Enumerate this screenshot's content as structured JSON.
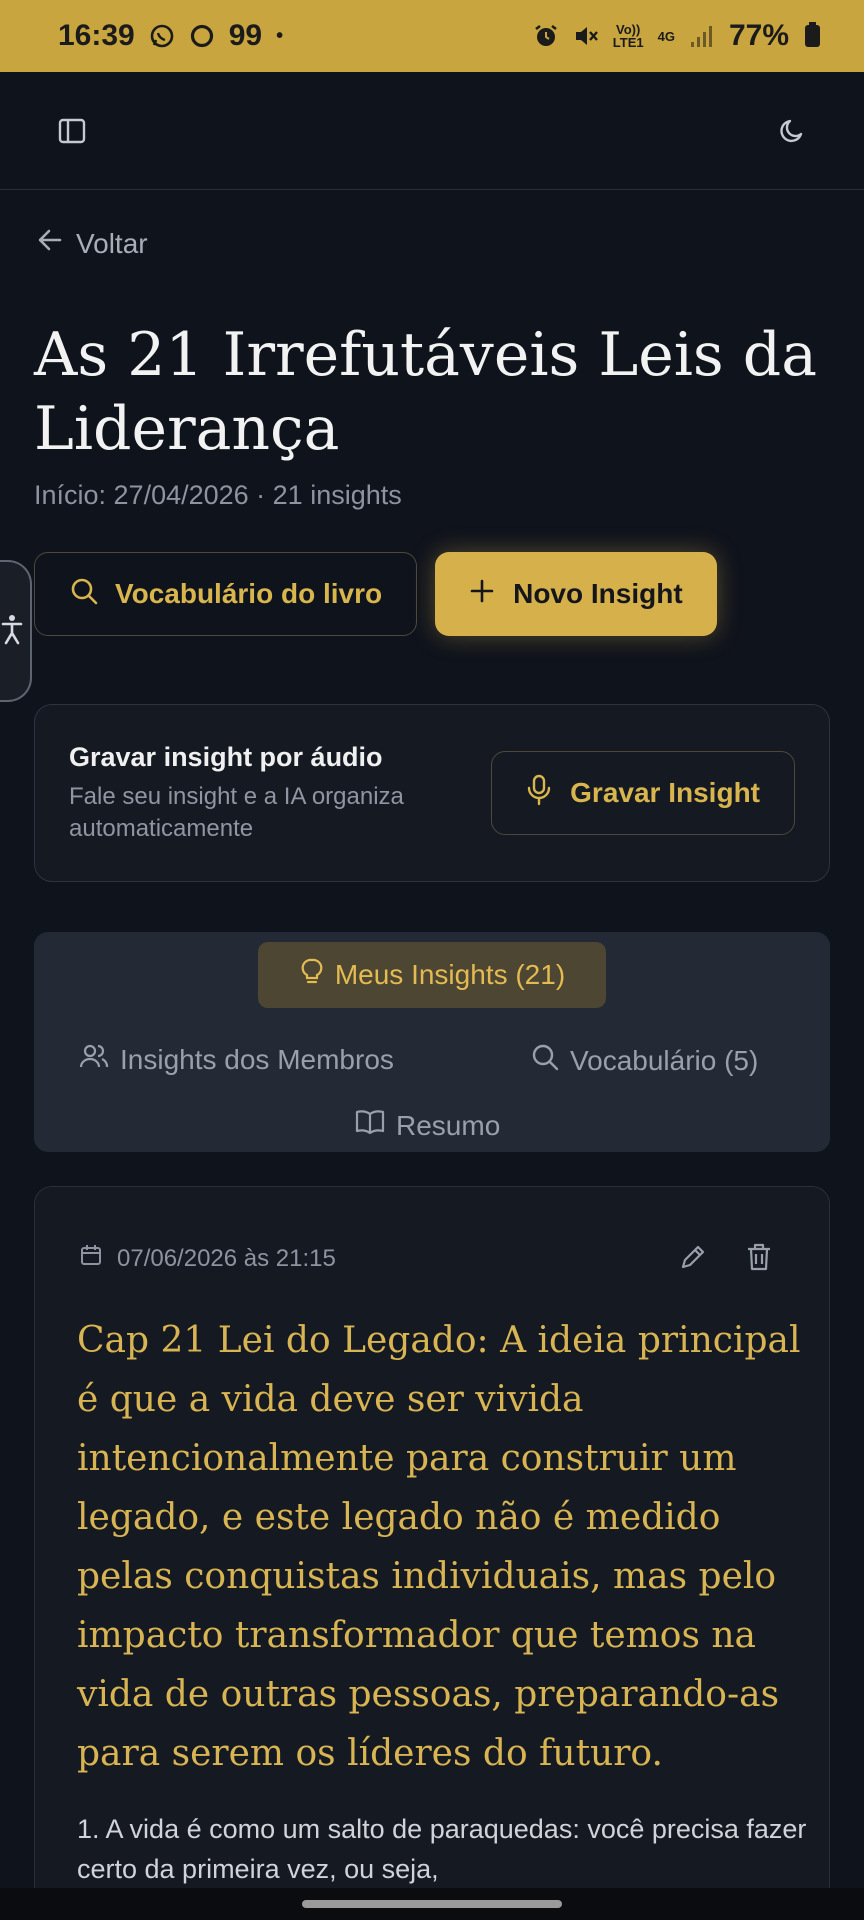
{
  "status": {
    "time": "16:39",
    "notif_count": "99",
    "network_small_top": "Vo))",
    "network_small_bottom": "LTE1",
    "net_type": "4G",
    "battery": "77%"
  },
  "back": {
    "label": "Voltar"
  },
  "book": {
    "title": "As 21 Irrefutáveis Leis da Liderança",
    "meta": "Início: 27/04/2026 · 21 insights"
  },
  "actions": {
    "vocab_label": "Vocabulário do livro",
    "new_insight_label": "Novo Insight"
  },
  "audio": {
    "title": "Gravar insight por áudio",
    "description": "Fale seu insight e a IA organiza automaticamente",
    "button_label": "Gravar Insight"
  },
  "tabs": {
    "my_insights": "Meus Insights (21)",
    "members": "Insights dos Membros",
    "vocabulary": "Vocabulário (5)",
    "summary": "Resumo"
  },
  "insight": {
    "date": "07/06/2026 às 21:15",
    "title": "Cap 21 Lei do Legado: A ideia principal é que a vida deve ser vivida intencionalmente para construir um legado, e este legado não é medido pelas conquistas individuais, mas pelo impacto transformador que temos na vida de outras pessoas, preparando-as para serem os líderes do futuro.",
    "body": "1. A vida é como um salto de paraquedas: você precisa fazer certo da primeira vez, ou seja,"
  },
  "colors": {
    "accent": "#d6b04a",
    "statusbar": "#c9a53f",
    "background": "#0f131c"
  }
}
